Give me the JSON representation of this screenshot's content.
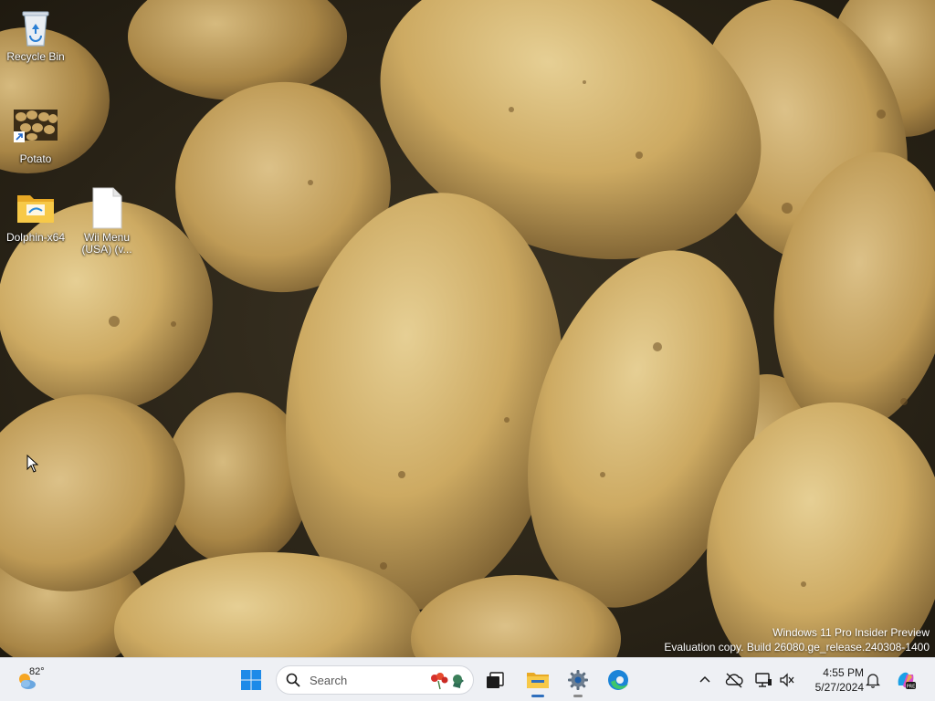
{
  "desktop": {
    "icons": [
      {
        "label": "Recycle Bin",
        "icon": "recycle-bin-icon"
      },
      {
        "label": "Potato",
        "icon": "potato-image-icon"
      },
      {
        "label": "Dolphin-x64",
        "icon": "folder-icon"
      },
      {
        "label": "Wii Menu (USA) (v...",
        "icon": "file-icon"
      }
    ],
    "watermark": {
      "line1": "Windows 11 Pro Insider Preview",
      "line2": "Evaluation copy. Build 26080.ge_release.240308-1400"
    }
  },
  "taskbar": {
    "weather": {
      "temp": "82°",
      "icon": "weather-sun-cloud-icon"
    },
    "start_icon": "windows-logo-icon",
    "search": {
      "placeholder": "Search"
    },
    "apps": [
      {
        "name": "Task View",
        "icon": "task-view-icon"
      },
      {
        "name": "File Explorer",
        "icon": "file-explorer-icon"
      },
      {
        "name": "Settings",
        "icon": "settings-gear-icon"
      },
      {
        "name": "Microsoft Edge",
        "icon": "edge-icon"
      }
    ],
    "tray": {
      "icons": [
        "chevron-up-icon",
        "network-offline-icon",
        "display-icon",
        "volume-icon"
      ],
      "time": "4:55 PM",
      "date": "5/27/2024",
      "notification_icon": "bell-icon",
      "copilot_icon": "copilot-icon"
    }
  },
  "colors": {
    "taskbar_bg": "#eef0f4",
    "accent": "#0078d4"
  }
}
